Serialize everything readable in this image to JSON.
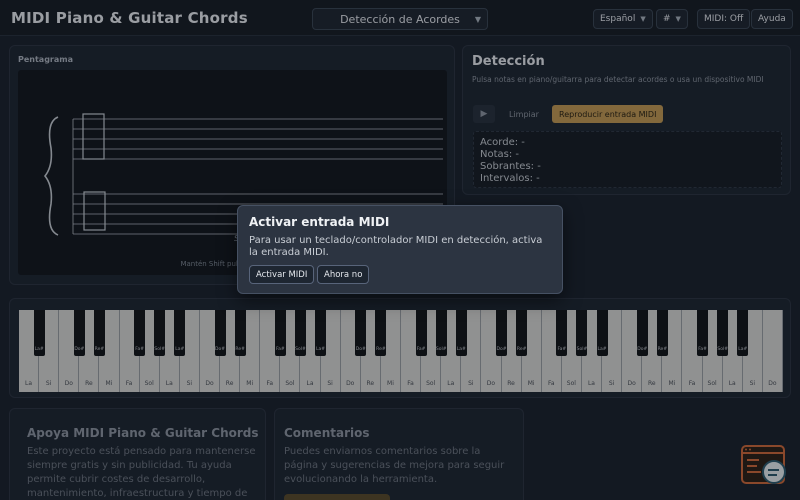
{
  "header": {
    "title": "MIDI Piano & Guitar Chords",
    "mode": "Detección de Acordes",
    "language": "Español",
    "accidental": "#",
    "midi_status": "MIDI: Off",
    "help": "Ayuda"
  },
  "staff": {
    "label": "Pentagrama",
    "empty_hint": "Sin notas",
    "footer": "Mantén Shift pulsado"
  },
  "detection": {
    "title": "Detección",
    "description": "Pulsa notas en piano/guitarra para detectar acordes o usa un dispositivo MIDI",
    "play_icon": "▶",
    "clear": "Limpiar",
    "play_midi": "Reproducir entrada MIDI",
    "results": {
      "chord": "Acorde: -",
      "notes": "Notas: -",
      "extra": "Sobrantes: -",
      "intervals": "Intervalos: -"
    }
  },
  "keyboard": {
    "white_keys": [
      "La",
      "Si",
      "Do",
      "Re",
      "Mi",
      "Fa",
      "Sol",
      "La",
      "Si",
      "Do",
      "Re",
      "Mi",
      "Fa",
      "Sol",
      "La",
      "Si",
      "Do",
      "Re",
      "Mi",
      "Fa",
      "Sol",
      "La",
      "Si",
      "Do",
      "Re",
      "Mi",
      "Fa",
      "Sol",
      "La",
      "Si",
      "Do",
      "Re",
      "Mi",
      "Fa",
      "Sol",
      "La",
      "Si",
      "Do"
    ],
    "black_keys": [
      {
        "after": 0,
        "label": "La#"
      },
      {
        "after": 2,
        "label": "Do#"
      },
      {
        "after": 3,
        "label": "Re#"
      },
      {
        "after": 5,
        "label": "Fa#"
      },
      {
        "after": 6,
        "label": "Sol#"
      },
      {
        "after": 7,
        "label": "La#"
      },
      {
        "after": 9,
        "label": "Do#"
      },
      {
        "after": 10,
        "label": "Re#"
      },
      {
        "after": 12,
        "label": "Fa#"
      },
      {
        "after": 13,
        "label": "Sol#"
      },
      {
        "after": 14,
        "label": "La#"
      },
      {
        "after": 16,
        "label": "Do#"
      },
      {
        "after": 17,
        "label": "Re#"
      },
      {
        "after": 19,
        "label": "Fa#"
      },
      {
        "after": 20,
        "label": "Sol#"
      },
      {
        "after": 21,
        "label": "La#"
      },
      {
        "after": 23,
        "label": "Do#"
      },
      {
        "after": 24,
        "label": "Re#"
      },
      {
        "after": 26,
        "label": "Fa#"
      },
      {
        "after": 27,
        "label": "Sol#"
      },
      {
        "after": 28,
        "label": "La#"
      },
      {
        "after": 30,
        "label": "Do#"
      },
      {
        "after": 31,
        "label": "Re#"
      },
      {
        "after": 33,
        "label": "Fa#"
      },
      {
        "after": 34,
        "label": "Sol#"
      },
      {
        "after": 35,
        "label": "La#"
      }
    ]
  },
  "support": {
    "title": "Apoya MIDI Piano & Guitar Chords",
    "text": "Este proyecto está pensado para mantenerse siempre gratis y sin publicidad. Tu ayuda permite cubrir costes de desarrollo, mantenimiento, infraestructura y tiempo de"
  },
  "comments": {
    "title": "Comentarios",
    "text": "Puedes enviarnos comentarios sobre la página y sugerencias de mejora para seguir evolucionando la herramienta."
  },
  "modal": {
    "title": "Activar entrada MIDI",
    "text": "Para usar un teclado/controlador MIDI en detección, activa la entrada MIDI.",
    "activate": "Activar MIDI",
    "dismiss": "Ahora no"
  },
  "colors": {
    "accent": "#c49a54",
    "background": "#1a212b",
    "panel": "#1d2530"
  },
  "icons": {
    "help_fab": "feedback-chat-icon"
  }
}
